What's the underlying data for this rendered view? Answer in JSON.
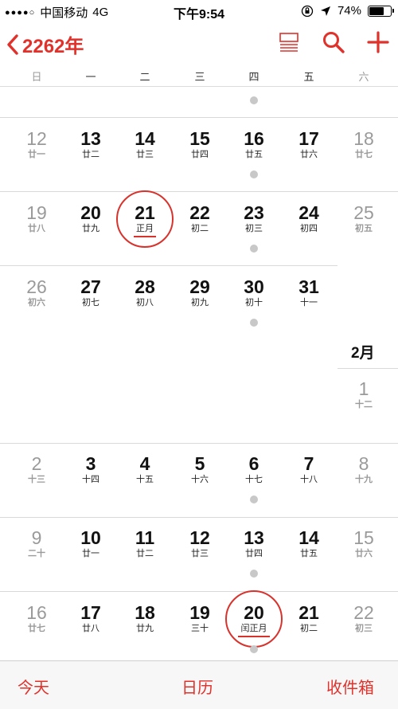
{
  "status_bar": {
    "signal_dots": "●●●●○",
    "carrier": "中国移动",
    "network": "4G",
    "time": "下午9:54",
    "battery_percent": "74%",
    "battery_level": 0.74,
    "icons": [
      "orientation-lock-icon",
      "location-arrow-icon"
    ]
  },
  "nav": {
    "back_label": "2262年",
    "icons": [
      "list-view-icon",
      "search-icon",
      "add-icon"
    ]
  },
  "weekdays": [
    "日",
    "一",
    "二",
    "三",
    "四",
    "五",
    "六"
  ],
  "calendar": {
    "accent_color": "#e0312b",
    "month_labels": [
      "2月"
    ],
    "weeks": [
      {
        "days": [],
        "event_days": [
          "四"
        ]
      },
      {
        "days": [
          {
            "num": "12",
            "lunar": "廿一"
          },
          {
            "num": "13",
            "lunar": "廿二"
          },
          {
            "num": "14",
            "lunar": "廿三"
          },
          {
            "num": "15",
            "lunar": "廿四"
          },
          {
            "num": "16",
            "lunar": "廿五"
          },
          {
            "num": "17",
            "lunar": "廿六"
          },
          {
            "num": "18",
            "lunar": "廿七"
          }
        ],
        "event_days": [
          "四"
        ]
      },
      {
        "days": [
          {
            "num": "19",
            "lunar": "廿八"
          },
          {
            "num": "20",
            "lunar": "廿九"
          },
          {
            "num": "21",
            "lunar": "正月",
            "circled": true
          },
          {
            "num": "22",
            "lunar": "初二"
          },
          {
            "num": "23",
            "lunar": "初三"
          },
          {
            "num": "24",
            "lunar": "初四"
          },
          {
            "num": "25",
            "lunar": "初五"
          }
        ],
        "event_days": [
          "四"
        ]
      },
      {
        "days": [
          {
            "num": "26",
            "lunar": "初六"
          },
          {
            "num": "27",
            "lunar": "初七"
          },
          {
            "num": "28",
            "lunar": "初八"
          },
          {
            "num": "29",
            "lunar": "初九"
          },
          {
            "num": "30",
            "lunar": "初十"
          },
          {
            "num": "31",
            "lunar": "十一"
          },
          {
            "num": "1",
            "lunar": "十二"
          }
        ],
        "event_days": [
          "四"
        ]
      },
      {
        "days": [
          {
            "num": "2",
            "lunar": "十三"
          },
          {
            "num": "3",
            "lunar": "十四"
          },
          {
            "num": "4",
            "lunar": "十五"
          },
          {
            "num": "5",
            "lunar": "十六"
          },
          {
            "num": "6",
            "lunar": "十七"
          },
          {
            "num": "7",
            "lunar": "十八"
          },
          {
            "num": "8",
            "lunar": "十九"
          }
        ],
        "event_days": [
          "四"
        ]
      },
      {
        "days": [
          {
            "num": "9",
            "lunar": "二十"
          },
          {
            "num": "10",
            "lunar": "廿一"
          },
          {
            "num": "11",
            "lunar": "廿二"
          },
          {
            "num": "12",
            "lunar": "廿三"
          },
          {
            "num": "13",
            "lunar": "廿四"
          },
          {
            "num": "14",
            "lunar": "廿五"
          },
          {
            "num": "15",
            "lunar": "廿六"
          }
        ],
        "event_days": [
          "四"
        ]
      },
      {
        "days": [
          {
            "num": "16",
            "lunar": "廿七"
          },
          {
            "num": "17",
            "lunar": "廿八"
          },
          {
            "num": "18",
            "lunar": "廿九"
          },
          {
            "num": "19",
            "lunar": "三十"
          },
          {
            "num": "20",
            "lunar": "闰正月",
            "circled": true
          },
          {
            "num": "21",
            "lunar": "初二"
          },
          {
            "num": "22",
            "lunar": "初三"
          }
        ],
        "event_days": [
          "四"
        ]
      }
    ]
  },
  "tabbar": {
    "today": "今天",
    "calendars": "日历",
    "inbox": "收件箱"
  }
}
